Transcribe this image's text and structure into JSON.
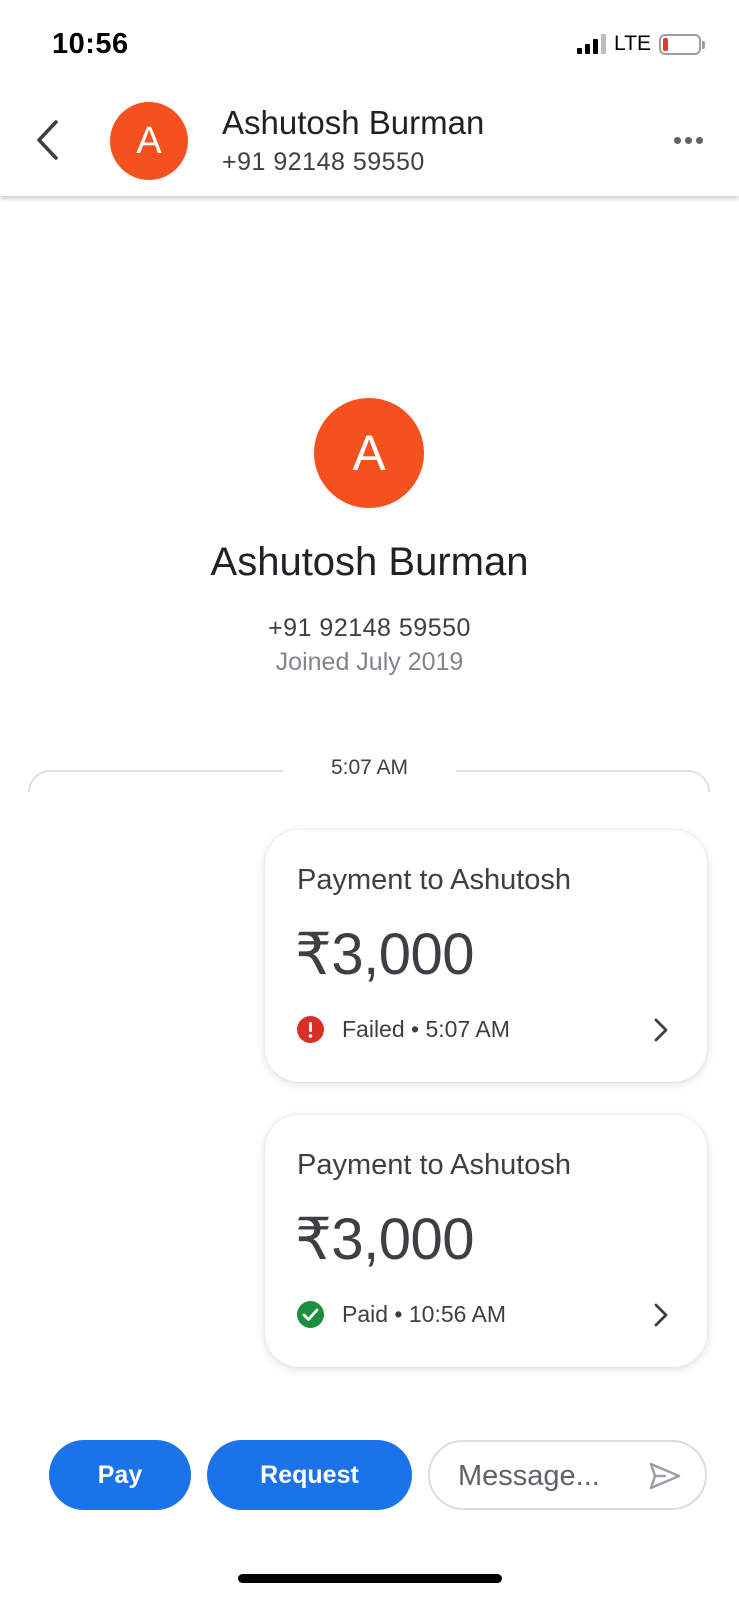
{
  "status_bar": {
    "time": "10:56",
    "network": "LTE",
    "battery_level": 0.1,
    "battery_color": "#e53935"
  },
  "header": {
    "avatar_initial": "A",
    "name": "Ashutosh Burman",
    "phone": "+91 92148 59550",
    "avatar_color": "#f4511e",
    "back_icon": "chevron-left-icon",
    "more_icon": "more-horizontal-icon"
  },
  "profile": {
    "avatar_initial": "A",
    "name": "Ashutosh Burman",
    "phone": "+91 92148 59550",
    "joined": "Joined July 2019"
  },
  "divider": {
    "time": "5:07 AM"
  },
  "payments": [
    {
      "title": "Payment to Ashutosh",
      "amount": "₹3,000",
      "status": "Failed",
      "time": "5:07 AM",
      "status_label": "Failed • 5:07 AM",
      "status_icon": "error-icon",
      "status_color": "#d93025"
    },
    {
      "title": "Payment to Ashutosh",
      "amount": "₹3,000",
      "status": "Paid",
      "time": "10:56 AM",
      "status_label": "Paid • 10:56 AM",
      "status_icon": "check-circle-icon",
      "status_color": "#1e8e3e"
    }
  ],
  "bottom_bar": {
    "pay_label": "Pay",
    "request_label": "Request",
    "message_placeholder": "Message...",
    "send_icon": "send-icon",
    "accent_color": "#1a73e8"
  }
}
